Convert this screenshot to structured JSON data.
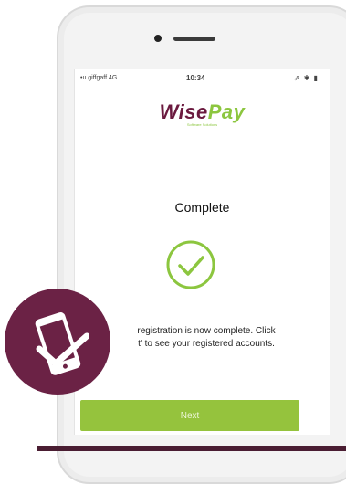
{
  "status_bar": {
    "carrier": "•ıı giffgaff  4G",
    "time": "10:34",
    "right_icons": "⇗ ✱ ▮"
  },
  "logo": {
    "part1": "Wise",
    "part2": "Pay",
    "tagline": "Software Solutions"
  },
  "screen": {
    "title": "Complete",
    "message_line1": "registration is now complete. Click",
    "message_line2": "t' to see your registered accounts.",
    "next_label": "Next"
  },
  "icons": {
    "check": "check-circle-icon",
    "badge": "phone-check-icon"
  },
  "colors": {
    "brand_purple": "#6b1a3f",
    "brand_green": "#8cc63f",
    "button_green": "#95c33d",
    "badge_purple": "#6b2245"
  }
}
